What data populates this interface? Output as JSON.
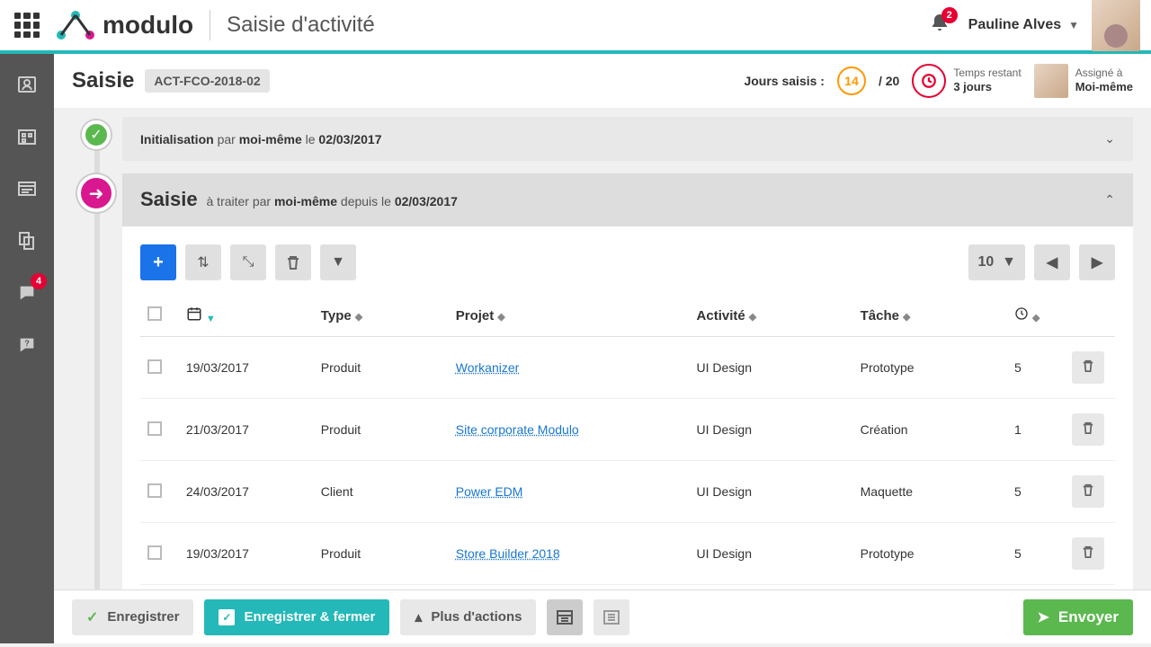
{
  "header": {
    "app_name": "modulo",
    "page_title": "Saisie d'activité",
    "notif_count": "2",
    "user_name": "Pauline Alves"
  },
  "sidebar": {
    "chat_badge": "4"
  },
  "titlebar": {
    "title": "Saisie",
    "ref": "ACT-FCO-2018-02",
    "days_label": "Jours saisis :",
    "days_entered": "14",
    "days_total": "/ 20",
    "time_label": "Temps restant",
    "time_value": "3 jours",
    "assigned_label": "Assigné à",
    "assigned_value": "Moi-même"
  },
  "steps": {
    "init": {
      "label": "Initialisation",
      "by": "par",
      "who": "moi-même",
      "on": "le",
      "date": "02/03/2017"
    },
    "saisie": {
      "title": "Saisie",
      "by": "à traiter par",
      "who": "moi-même",
      "since": "depuis le",
      "date": "02/03/2017"
    }
  },
  "table": {
    "page_size": "10",
    "cols": {
      "date": "",
      "type": "Type",
      "projet": "Projet",
      "activite": "Activité",
      "tache": "Tâche",
      "time": ""
    },
    "rows": [
      {
        "date": "19/03/2017",
        "type": "Produit",
        "projet": "Workanizer",
        "activite": "UI Design",
        "tache": "Prototype",
        "time": "5"
      },
      {
        "date": "21/03/2017",
        "type": "Produit",
        "projet": "Site corporate Modulo",
        "activite": "UI Design",
        "tache": "Création",
        "time": "1"
      },
      {
        "date": "24/03/2017",
        "type": "Client",
        "projet": "Power EDM",
        "activite": "UI Design",
        "tache": "Maquette",
        "time": "5"
      },
      {
        "date": "19/03/2017",
        "type": "Produit",
        "projet": "Store Builder 2018",
        "activite": "UI Design",
        "tache": "Prototype",
        "time": "5"
      }
    ]
  },
  "footer": {
    "save": "Enregistrer",
    "save_close": "Enregistrer & fermer",
    "more": "Plus d'actions",
    "send": "Envoyer"
  }
}
